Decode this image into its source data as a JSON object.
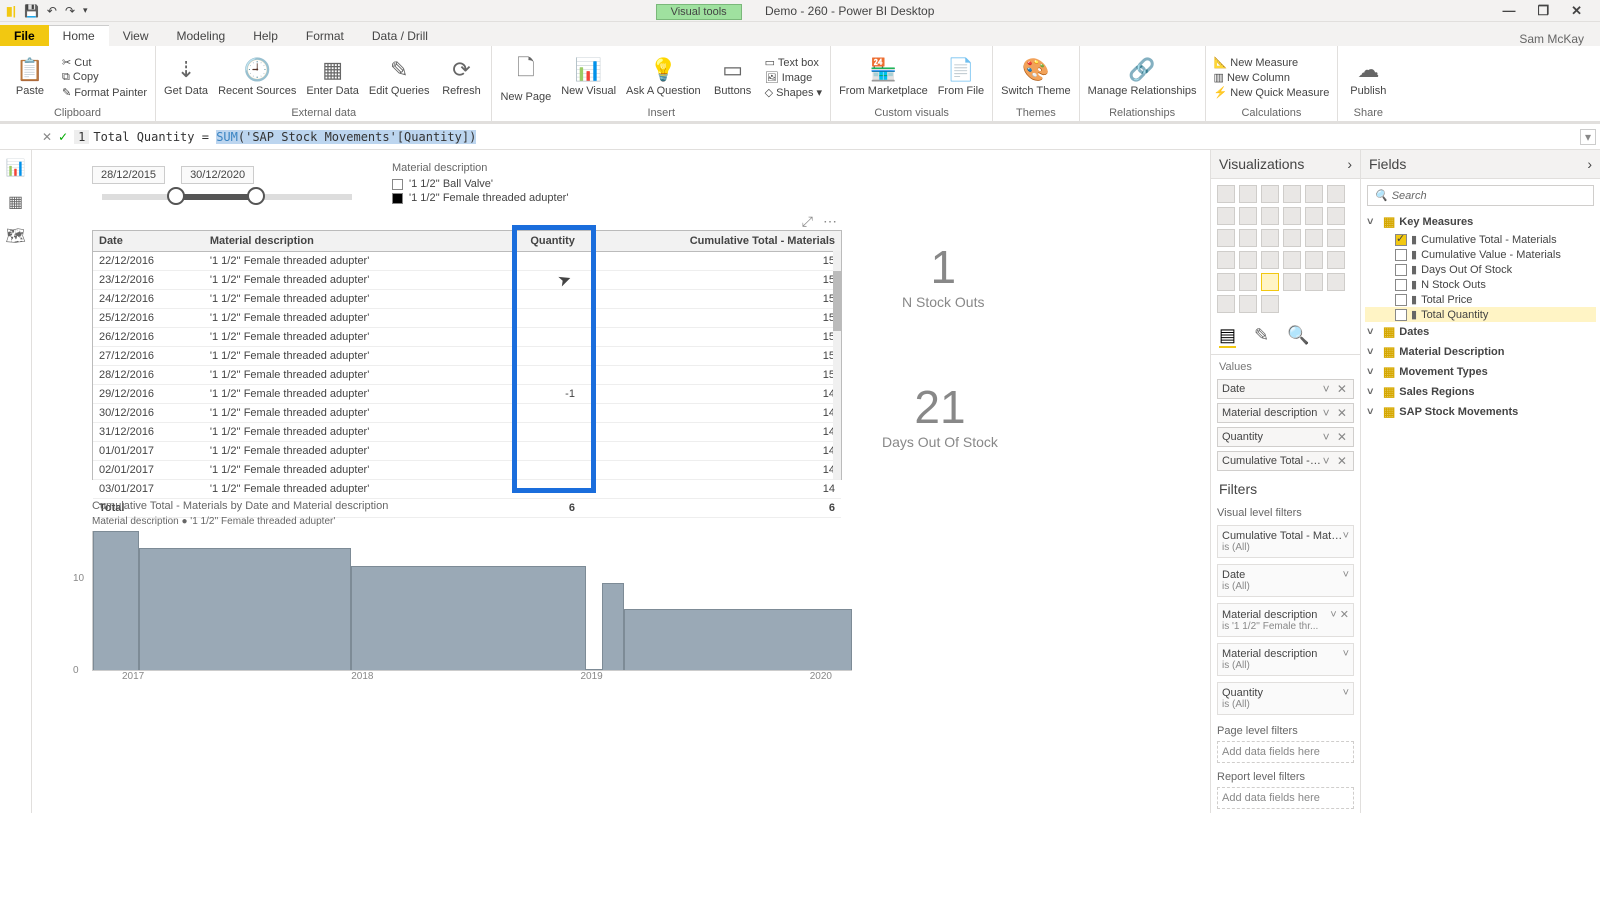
{
  "title": "Demo - 260 - Power BI Desktop",
  "visual_tools_label": "Visual tools",
  "user": "Sam McKay",
  "tabs": [
    "File",
    "Home",
    "View",
    "Modeling",
    "Help",
    "Format",
    "Data / Drill"
  ],
  "ribbon": {
    "clipboard_label": "Clipboard",
    "paste": "Paste",
    "cut": "Cut",
    "copy": "Copy",
    "format_painter": "Format Painter",
    "external_label": "External data",
    "get_data": "Get Data",
    "recent": "Recent Sources",
    "enter": "Enter Data",
    "edit_q": "Edit Queries",
    "refresh": "Refresh",
    "insert_label": "Insert",
    "new_page": "New Page",
    "new_visual": "New Visual",
    "ask": "Ask A Question",
    "buttons": "Buttons",
    "textbox": "Text box",
    "image": "Image",
    "shapes": "Shapes",
    "custom_label": "Custom visuals",
    "marketplace": "From Marketplace",
    "from_file": "From File",
    "themes_label": "Themes",
    "switch_theme": "Switch Theme",
    "rel_label": "Relationships",
    "manage_rel": "Manage Relationships",
    "calc_label": "Calculations",
    "new_measure": "New Measure",
    "new_column": "New Column",
    "new_quick": "New Quick Measure",
    "share_label": "Share",
    "publish": "Publish"
  },
  "formula": {
    "line": "1",
    "name": "Total Quantity = ",
    "fn": "SUM",
    "arg": "('SAP Stock Movements'[Quantity])"
  },
  "slicer": {
    "start": "28/12/2015",
    "end": "30/12/2020"
  },
  "legend": {
    "title": "Material description",
    "items": [
      {
        "label": "'1 1/2'' Ball Valve'",
        "checked": false
      },
      {
        "label": "'1 1/2'' Female threaded adupter'",
        "checked": true
      }
    ]
  },
  "table": {
    "columns": [
      "Date",
      "Material description",
      "Quantity",
      "Cumulative Total - Materials"
    ],
    "rows": [
      {
        "d": "22/12/2016",
        "m": "'1 1/2'' Female threaded adupter'",
        "q": "",
        "c": "15"
      },
      {
        "d": "23/12/2016",
        "m": "'1 1/2'' Female threaded adupter'",
        "q": "",
        "c": "15"
      },
      {
        "d": "24/12/2016",
        "m": "'1 1/2'' Female threaded adupter'",
        "q": "",
        "c": "15"
      },
      {
        "d": "25/12/2016",
        "m": "'1 1/2'' Female threaded adupter'",
        "q": "",
        "c": "15"
      },
      {
        "d": "26/12/2016",
        "m": "'1 1/2'' Female threaded adupter'",
        "q": "",
        "c": "15"
      },
      {
        "d": "27/12/2016",
        "m": "'1 1/2'' Female threaded adupter'",
        "q": "",
        "c": "15"
      },
      {
        "d": "28/12/2016",
        "m": "'1 1/2'' Female threaded adupter'",
        "q": "",
        "c": "15"
      },
      {
        "d": "29/12/2016",
        "m": "'1 1/2'' Female threaded adupter'",
        "q": "-1",
        "c": "14"
      },
      {
        "d": "30/12/2016",
        "m": "'1 1/2'' Female threaded adupter'",
        "q": "",
        "c": "14"
      },
      {
        "d": "31/12/2016",
        "m": "'1 1/2'' Female threaded adupter'",
        "q": "",
        "c": "14"
      },
      {
        "d": "01/01/2017",
        "m": "'1 1/2'' Female threaded adupter'",
        "q": "",
        "c": "14"
      },
      {
        "d": "02/01/2017",
        "m": "'1 1/2'' Female threaded adupter'",
        "q": "",
        "c": "14"
      },
      {
        "d": "03/01/2017",
        "m": "'1 1/2'' Female threaded adupter'",
        "q": "",
        "c": "14"
      }
    ],
    "total_row": {
      "d": "Total",
      "q": "6",
      "c": "6"
    }
  },
  "kpi1": {
    "value": "1",
    "label": "N Stock Outs"
  },
  "kpi2": {
    "value": "21",
    "label": "Days Out Of Stock"
  },
  "chart_data": {
    "type": "area",
    "title": "Cumulative Total - Materials by Date and Material description",
    "legend": "Material description  ● '1 1/2'' Female threaded adupter'",
    "xlabel": "",
    "ylabel": "",
    "y_ticks": [
      0,
      10
    ],
    "x_ticks": [
      "2017",
      "2018",
      "2019",
      "2020"
    ],
    "series": [
      {
        "name": "'1 1/2'' Female threaded adupter'",
        "steps": [
          {
            "x0": 0.0,
            "x1": 0.06,
            "y": 16
          },
          {
            "x0": 0.06,
            "x1": 0.34,
            "y": 14
          },
          {
            "x0": 0.34,
            "x1": 0.65,
            "y": 12
          },
          {
            "x0": 0.65,
            "x1": 0.67,
            "y": 0
          },
          {
            "x0": 0.67,
            "x1": 0.7,
            "y": 10
          },
          {
            "x0": 0.7,
            "x1": 1.0,
            "y": 7
          }
        ],
        "ylim": [
          0,
          16
        ]
      }
    ]
  },
  "vis_pane": {
    "title": "Visualizations",
    "values_h": "Values",
    "wells": [
      "Date",
      "Material description",
      "Quantity",
      "Cumulative Total - Mate..."
    ],
    "filters_h": "Filters",
    "visual_level": "Visual level filters",
    "filters": [
      {
        "name": "Cumulative Total - Mate...",
        "sub": "is (All)",
        "x": false
      },
      {
        "name": "Date",
        "sub": "is (All)",
        "x": false
      },
      {
        "name": "Material description",
        "sub": "is '1 1/2'' Female thr...",
        "x": true
      },
      {
        "name": "Material description",
        "sub": "is (All)",
        "x": false
      },
      {
        "name": "Quantity",
        "sub": "is (All)",
        "x": false
      }
    ],
    "page_level": "Page level filters",
    "add_here": "Add data fields here",
    "report_level": "Report level filters"
  },
  "fields_pane": {
    "title": "Fields",
    "search": "Search",
    "key_measures": "Key Measures",
    "measures": [
      {
        "label": "Cumulative Total - Materials",
        "checked": true
      },
      {
        "label": "Cumulative Value - Materials",
        "checked": false
      },
      {
        "label": "Days Out Of Stock",
        "checked": false
      },
      {
        "label": "N Stock Outs",
        "checked": false
      },
      {
        "label": "Total Price",
        "checked": false
      },
      {
        "label": "Total Quantity",
        "checked": false,
        "sel": true
      }
    ],
    "tables": [
      "Dates",
      "Material Description",
      "Movement Types",
      "Sales Regions",
      "SAP Stock Movements"
    ]
  }
}
